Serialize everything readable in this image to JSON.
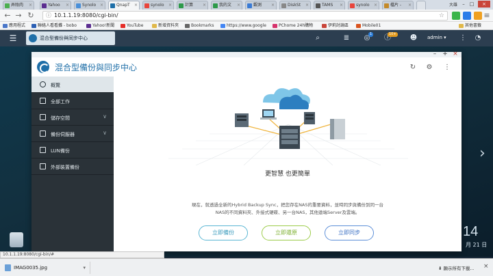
{
  "browser": {
    "tabs": [
      "弄陰肉",
      "Yahoo",
      "Synolo",
      "QnapT",
      "synolo",
      "計算",
      "我的文",
      "觀測",
      "DiskSt",
      "TAMS",
      "synolo",
      "檔片 -"
    ],
    "active_tab_index": 3,
    "window_user": "大雄",
    "url": "10.1.1.19:8080/cgi-bin/",
    "bookmarks": [
      "應用程式",
      "聯絡人看看攤 - bobo",
      "Yahoo!新聞",
      "YouTube",
      "新增資料夾",
      "Bookmarks",
      "https://www.google",
      "PChome 24h購物",
      "伊莉討論區",
      "Mobile01"
    ],
    "other_bookmarks": "其他書籤",
    "status_url": "10.1.1.19:8080/cgi-bin/#",
    "download_file": "IMAG0035.jpg",
    "show_all_downloads": "顯示所有下載...",
    "accent": "#1f6fa8"
  },
  "qts": {
    "app_tab_label": "混合型備份與同步中心",
    "notification_badge": "1",
    "info_badge": "10+",
    "admin_label": "admin",
    "clock_time": "14",
    "clock_date": "月 21 日"
  },
  "app": {
    "title": "混合型備份與同步中心",
    "sidebar": {
      "items": [
        {
          "label": "概覽"
        },
        {
          "label": "全部工作"
        },
        {
          "label": "儲存空間"
        },
        {
          "label": "備份伺服器"
        },
        {
          "label": "LUN備份"
        },
        {
          "label": "外部裝置備份"
        }
      ]
    },
    "overview": {
      "headline": "更智慧 也更簡單",
      "desc_line1": "現在，就透過全新的Hybrid Backup Sync，把您存在NAS的重要資料，並時同步與備份到同一台",
      "desc_line2": "NAS的不同資料夾、外接式硬碟、另一台NAS，其他遠端Server及雲端。",
      "buttons": {
        "backup": "立即備份",
        "restore": "立即還原",
        "sync": "立即同步"
      }
    }
  }
}
